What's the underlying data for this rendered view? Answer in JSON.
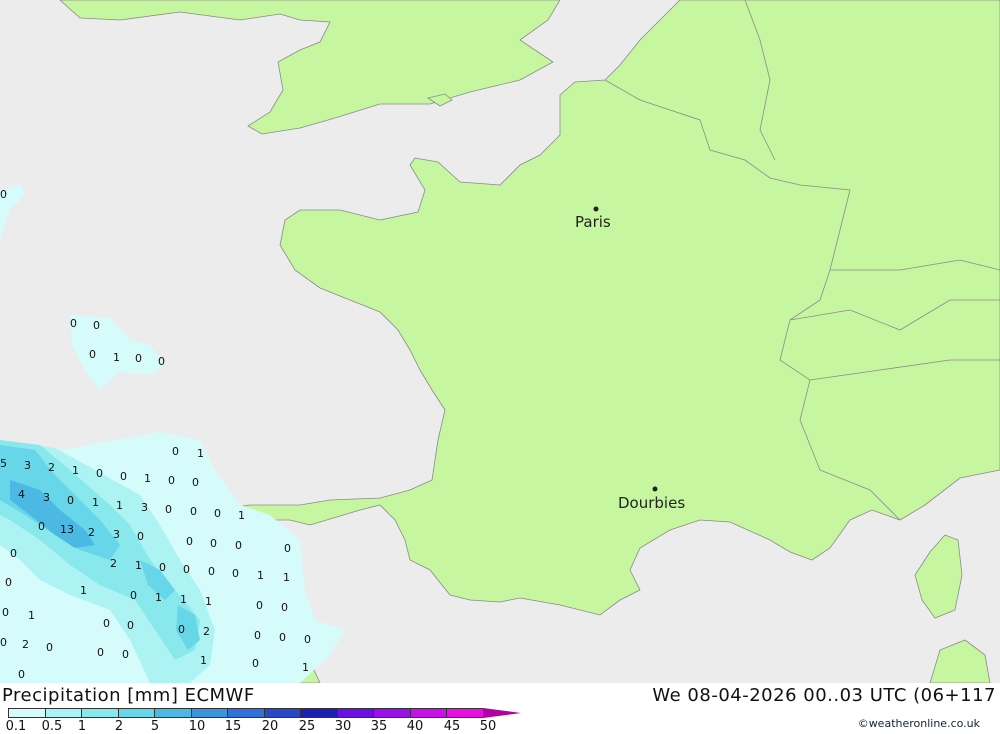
{
  "title": "Precipitation [mm] ECMWF",
  "datetime": "We 08-04-2026 00..03 UTC (06+117",
  "credit": "©weatheronline.co.uk",
  "colors": {
    "sea": "#ececec",
    "land": "#c6f7a0",
    "border": "#8a8a8a"
  },
  "legend": {
    "labels": [
      "0.1",
      "0.5",
      "1",
      "2",
      "5",
      "10",
      "15",
      "20",
      "25",
      "30",
      "35",
      "40",
      "45",
      "50"
    ],
    "colors": [
      "#d6fbfb",
      "#aef3f3",
      "#88e8ec",
      "#66d6e8",
      "#4cb8e4",
      "#3c94dc",
      "#3070d8",
      "#2848c8",
      "#1e20b0",
      "#6a10e0",
      "#9a10e8",
      "#c810e8",
      "#e810e0",
      "#b000a0"
    ]
  },
  "cities": [
    {
      "name": "Paris"
    },
    {
      "name": "Dourbies"
    }
  ],
  "precip_values": [
    "0",
    "0",
    "0",
    "1",
    "0",
    "0",
    "0",
    "5",
    "3",
    "2",
    "1",
    "0",
    "0",
    "1",
    "0",
    "0",
    "0",
    "1",
    "4",
    "3",
    "0",
    "1",
    "1",
    "3",
    "0",
    "0",
    "0",
    "1",
    "0",
    "13",
    "2",
    "3",
    "0",
    "0",
    "0",
    "0",
    "0",
    "0",
    "2",
    "1",
    "0",
    "0",
    "0",
    "0",
    "1",
    "1",
    "0",
    "1",
    "0",
    "1",
    "1",
    "1",
    "0",
    "0",
    "1",
    "0",
    "0",
    "0",
    "2",
    "0",
    "0",
    "0",
    "0",
    "0",
    "2",
    "0",
    "0",
    "0",
    "1",
    "0",
    "1",
    "0"
  ]
}
